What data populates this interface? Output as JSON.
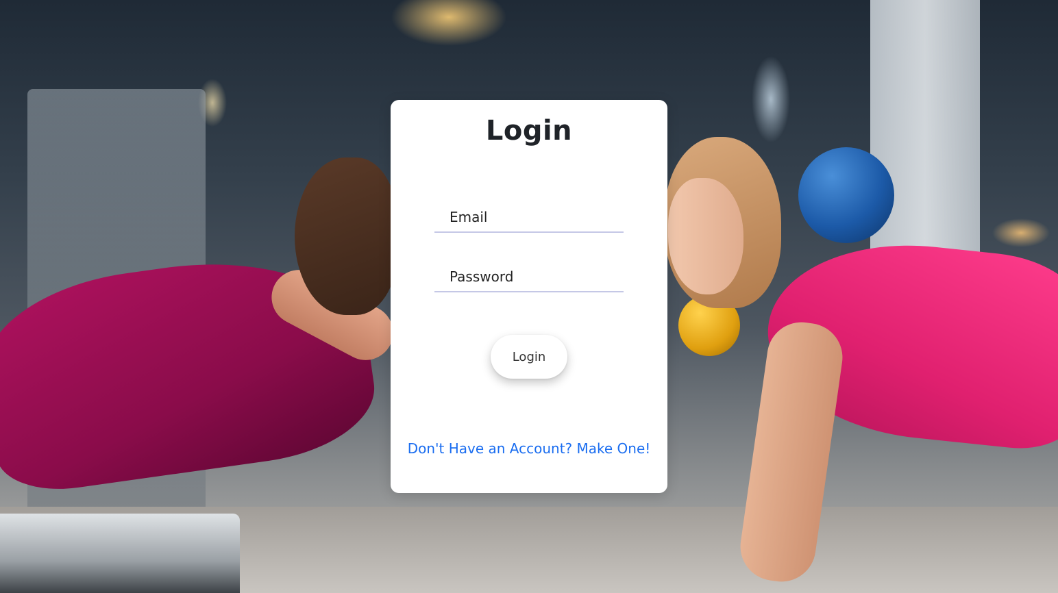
{
  "background": {
    "description_icon": "gym-photo"
  },
  "login_card": {
    "title": "Login",
    "email": {
      "value": "",
      "placeholder": "Email"
    },
    "password": {
      "value": "",
      "placeholder": "Password"
    },
    "submit_label": "Login",
    "signup_link_text": "Don't Have an Account? Make One!"
  },
  "colors": {
    "link": "#1a6df0",
    "field_underline": "#c5c8e6",
    "card_background": "#ffffff"
  }
}
